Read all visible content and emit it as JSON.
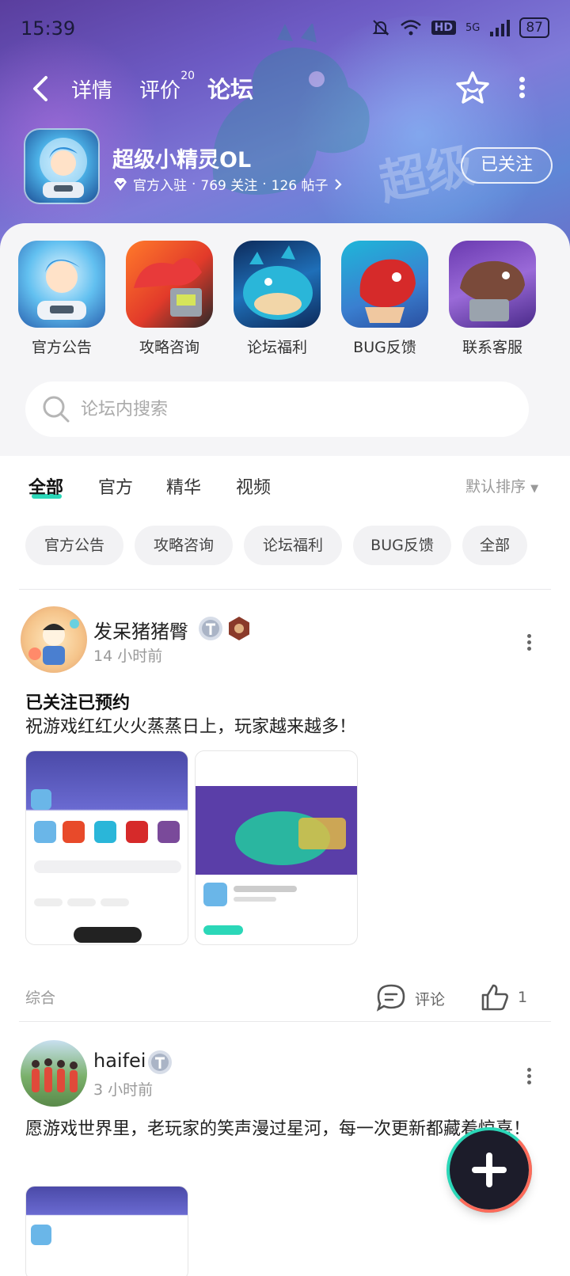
{
  "status": {
    "time": "15:39",
    "battery": "87",
    "network": "5G",
    "hd": "HD"
  },
  "nav": {
    "tabs": [
      {
        "label": "详情"
      },
      {
        "label": "评价",
        "count": "20"
      },
      {
        "label": "论坛"
      }
    ]
  },
  "game": {
    "name": "超级小精灵OL",
    "official": "官方入驻",
    "followers": "769 关注",
    "posts": "126 帖子",
    "follow_label": "已关注"
  },
  "categories": [
    {
      "label": "官方公告",
      "icon": "announcement-icon"
    },
    {
      "label": "攻略咨询",
      "icon": "guide-icon"
    },
    {
      "label": "论坛福利",
      "icon": "welfare-icon"
    },
    {
      "label": "BUG反馈",
      "icon": "bug-icon"
    },
    {
      "label": "联系客服",
      "icon": "support-icon"
    }
  ],
  "search": {
    "placeholder": "论坛内搜索"
  },
  "feed_tabs": [
    {
      "label": "全部"
    },
    {
      "label": "官方"
    },
    {
      "label": "精华"
    },
    {
      "label": "视频"
    }
  ],
  "sort": "默认排序",
  "chips": [
    {
      "label": "官方公告"
    },
    {
      "label": "攻略咨询"
    },
    {
      "label": "论坛福利"
    },
    {
      "label": "BUG反馈"
    },
    {
      "label": "全部"
    }
  ],
  "posts": [
    {
      "user": "发呆猪猪臀",
      "time": "14 小时前",
      "title": "已关注已预约",
      "body": "祝游戏红红火火蒸蒸日上，玩家越来越多！",
      "tag": "综合",
      "comment_label": "评论",
      "likes": "1"
    },
    {
      "user": "haifei",
      "time": "3 小时前",
      "body": "愿游戏世界里，老玩家的笑声漫过星河，每一次更新都藏着惊喜！"
    }
  ],
  "colors": {
    "accent": "#2bd7b8",
    "hero": "#6d5bc4"
  }
}
